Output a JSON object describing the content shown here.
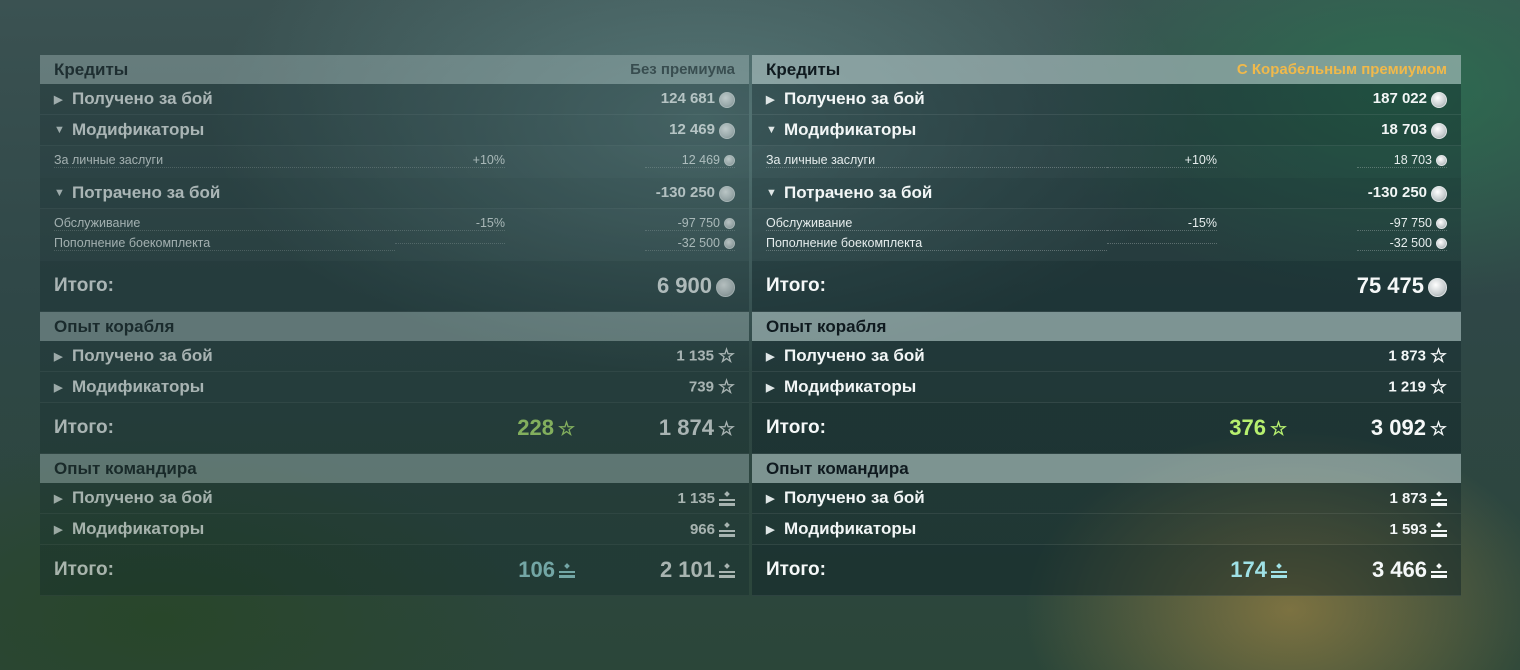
{
  "left": {
    "credits": {
      "title": "Кредиты",
      "badge": "Без премиума",
      "received": {
        "label": "Получено за бой",
        "value": "124 681"
      },
      "modifiers": {
        "label": "Модификаторы",
        "value": "12 469"
      },
      "merit": {
        "label": "За личные заслуги",
        "pct": "+10%",
        "value": "12 469"
      },
      "spent": {
        "label": "Потрачено за бой",
        "value": "-130 250"
      },
      "service": {
        "label": "Обслуживание",
        "pct": "-15%",
        "value": "-97 750"
      },
      "ammo": {
        "label": "Пополнение боекомплекта",
        "value": "-32 500"
      },
      "total": {
        "label": "Итого:",
        "value": "6 900"
      }
    },
    "ship_xp": {
      "title": "Опыт корабля",
      "received": {
        "label": "Получено за бой",
        "value": "1 135"
      },
      "modifiers": {
        "label": "Модификаторы",
        "value": "739"
      },
      "total": {
        "label": "Итого:",
        "free": "228",
        "value": "1 874"
      }
    },
    "commander_xp": {
      "title": "Опыт командира",
      "received": {
        "label": "Получено за бой",
        "value": "1 135"
      },
      "modifiers": {
        "label": "Модификаторы",
        "value": "966"
      },
      "total": {
        "label": "Итого:",
        "free": "106",
        "value": "2 101"
      }
    }
  },
  "right": {
    "credits": {
      "title": "Кредиты",
      "badge": "С Корабельным премиумом",
      "received": {
        "label": "Получено за бой",
        "value": "187 022"
      },
      "modifiers": {
        "label": "Модификаторы",
        "value": "18 703"
      },
      "merit": {
        "label": "За личные заслуги",
        "pct": "+10%",
        "value": "18 703"
      },
      "spent": {
        "label": "Потрачено за бой",
        "value": "-130 250"
      },
      "service": {
        "label": "Обслуживание",
        "pct": "-15%",
        "value": "-97 750"
      },
      "ammo": {
        "label": "Пополнение боекомплекта",
        "value": "-32 500"
      },
      "total": {
        "label": "Итого:",
        "value": "75 475"
      }
    },
    "ship_xp": {
      "title": "Опыт корабля",
      "received": {
        "label": "Получено за бой",
        "value": "1 873"
      },
      "modifiers": {
        "label": "Модификаторы",
        "value": "1 219"
      },
      "total": {
        "label": "Итого:",
        "free": "376",
        "value": "3 092"
      }
    },
    "commander_xp": {
      "title": "Опыт командира",
      "received": {
        "label": "Получено за бой",
        "value": "1 873"
      },
      "modifiers": {
        "label": "Модификаторы",
        "value": "1 593"
      },
      "total": {
        "label": "Итого:",
        "free": "174",
        "value": "3 466"
      }
    }
  },
  "icons": {
    "arrow_collapsed": "caret-right-icon",
    "arrow_expanded": "caret-down-icon",
    "credits": "coin-icon",
    "ship_xp": "star-icon",
    "commander_xp": "commander-xp-icon"
  },
  "colors": {
    "premium_badge": "#f0b94b",
    "free_xp": "#b7f06f",
    "free_commander_xp": "#9fe1e6"
  }
}
